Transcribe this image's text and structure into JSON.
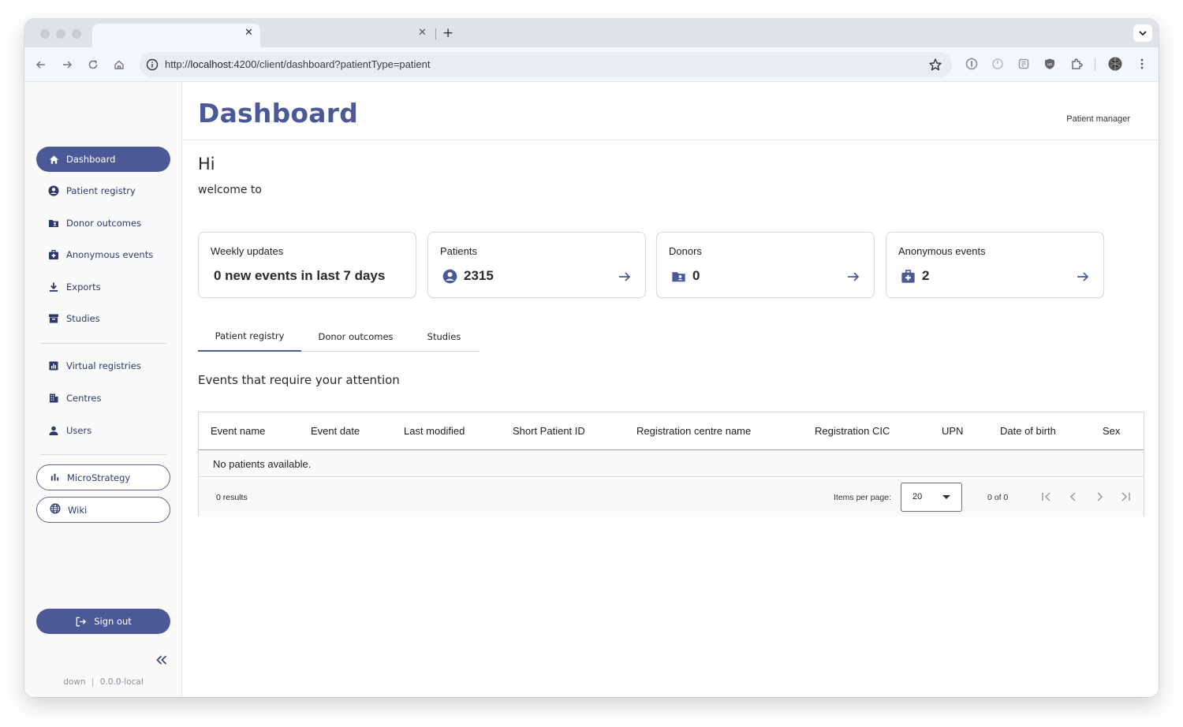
{
  "browser": {
    "url_prefix": "http://",
    "url_host": "localhost",
    "url_rest": ":4200/client/dashboard?patientType=patient"
  },
  "sidebar": {
    "items": [
      {
        "label": "Dashboard",
        "icon": "home-icon",
        "active": true
      },
      {
        "label": "Patient registry",
        "icon": "account-circle-icon"
      },
      {
        "label": "Donor outcomes",
        "icon": "folder-account-icon"
      },
      {
        "label": "Anonymous events",
        "icon": "medical-bag-icon"
      },
      {
        "label": "Exports",
        "icon": "download-icon"
      },
      {
        "label": "Studies",
        "icon": "archive-icon"
      }
    ],
    "items2": [
      {
        "label": "Virtual registries",
        "icon": "chart-box-icon"
      },
      {
        "label": "Centres",
        "icon": "building-icon"
      },
      {
        "label": "Users",
        "icon": "user-icon"
      }
    ],
    "links": [
      {
        "label": "MicroStrategy",
        "icon": "bar-chart-icon"
      },
      {
        "label": "Wiki",
        "icon": "globe-icon"
      }
    ],
    "signout": "Sign out",
    "version_left": "down",
    "version_right": "0.0.0-local"
  },
  "header": {
    "title": "Dashboard",
    "role": "Patient manager"
  },
  "greeting": {
    "hi": "Hi",
    "welcome": "welcome to"
  },
  "cards": [
    {
      "title": "Weekly updates",
      "value": "0 new events in last 7 days",
      "icon": ""
    },
    {
      "title": "Patients",
      "value": "2315",
      "icon": "account-circle-icon"
    },
    {
      "title": "Donors",
      "value": "0",
      "icon": "folder-account-icon"
    },
    {
      "title": "Anonymous events",
      "value": "2",
      "icon": "medical-bag-icon"
    }
  ],
  "tabs": [
    "Patient registry",
    "Donor outcomes",
    "Studies"
  ],
  "section_title": "Events that require your attention",
  "table": {
    "columns": [
      "Event name",
      "Event date",
      "Last modified",
      "Short Patient ID",
      "Registration centre name",
      "Registration CIC",
      "UPN",
      "Date of birth",
      "Sex"
    ],
    "empty": "No patients available."
  },
  "paginator": {
    "results": "0 results",
    "items_per_page_label": "Items per page:",
    "items_per_page": "20",
    "range": "0 of 0"
  },
  "colors": {
    "brand": "#4b5a97"
  }
}
